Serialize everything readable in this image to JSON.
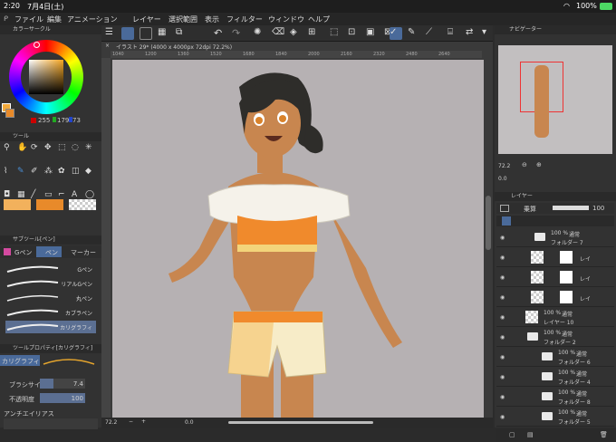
{
  "status": {
    "time": "2:20",
    "date": "7月4日(土)",
    "battery": "100%"
  },
  "menu": [
    "ファイル",
    "編集",
    "アニメーション",
    "レイヤー",
    "選択範囲",
    "表示",
    "フィルター",
    "ウィンドウ",
    "ヘルプ"
  ],
  "document_tab": "イラスト 29* (4000 x 4000px 72dpi 72.2%)",
  "ruler": [
    "1040",
    "1200",
    "1360",
    "1520",
    "1680",
    "1840",
    "2000",
    "2160",
    "2320",
    "2480",
    "2640"
  ],
  "left": {
    "color_circle": "カラーサークル",
    "hsv": [
      "255",
      "179",
      "73"
    ],
    "tool": "ツール",
    "subtool": "サブツール[ペン]",
    "subtool_tabs": [
      "Gペン",
      "ペン",
      "マーカー"
    ],
    "brushes": [
      "Gペン",
      "リアルGペン",
      "丸ペン",
      "カブラペン",
      "カリグラフィ"
    ],
    "tool_property": "ツールプロパティ[カリグラフィ]",
    "prop_name": "カリグラフィ",
    "brush_size_label": "ブラシサイズ",
    "brush_size": "7.4",
    "opacity_label": "不透明度",
    "opacity": "100",
    "antialias_label": "アンチエイリアス"
  },
  "navigator": {
    "title": "ナビゲーター",
    "zoom": "72.2",
    "angle": "0.0"
  },
  "layers": {
    "title": "レイヤー",
    "blend": "乗算",
    "opacity": "100",
    "rows": [
      {
        "pct": "100 %",
        "mode": "通常",
        "name": "フォルダー 7"
      },
      {
        "pct": "",
        "mode": "",
        "name": "レイ"
      },
      {
        "pct": "",
        "mode": "",
        "name": "レイ"
      },
      {
        "pct": "",
        "mode": "",
        "name": "レイ"
      },
      {
        "pct": "100 %",
        "mode": "通常",
        "name": "レイヤー 10"
      },
      {
        "pct": "100 %",
        "mode": "通常",
        "name": "フォルダー 2"
      },
      {
        "pct": "100 %",
        "mode": "通常",
        "name": "フォルダー 6"
      },
      {
        "pct": "100 %",
        "mode": "通常",
        "name": "フォルダー 4"
      },
      {
        "pct": "100 %",
        "mode": "通常",
        "name": "フォルダー 8"
      },
      {
        "pct": "100 %",
        "mode": "通常",
        "name": "フォルダー 5"
      }
    ]
  },
  "bottom": {
    "zoom": "72.2",
    "angle": "0.0"
  },
  "colors": {
    "main": "#f2a93b",
    "sub": "#e88a2a",
    "accent": "#4a8fd6"
  }
}
